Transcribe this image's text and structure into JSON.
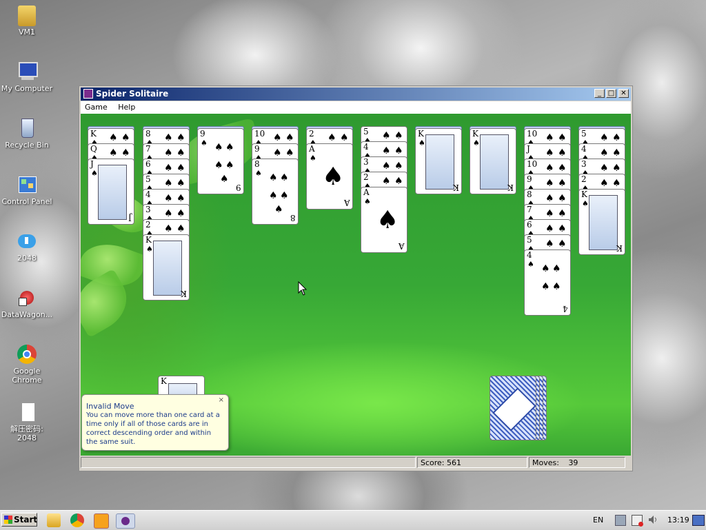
{
  "desktop": {
    "icons": [
      {
        "label": "VM1"
      },
      {
        "label": "My Computer"
      },
      {
        "label": "Recycle Bin"
      },
      {
        "label": "Control Panel"
      },
      {
        "label": "2048"
      },
      {
        "label": "DataWagon..."
      },
      {
        "label": "Google Chrome"
      },
      {
        "label": "解压密码: 2048"
      }
    ]
  },
  "window": {
    "title": "Spider Solitaire",
    "controls": {
      "minimize": "_",
      "maximize": "□",
      "close": "✕"
    },
    "menu": [
      "Game",
      "Help"
    ]
  },
  "tableau": {
    "columns": [
      {
        "cards": [
          "K",
          "Q",
          "J"
        ]
      },
      {
        "cards": [
          "8",
          "7",
          "6",
          "5",
          "4",
          "3",
          "2",
          "K"
        ]
      },
      {
        "cards": [
          "9"
        ]
      },
      {
        "cards": [
          "10",
          "9",
          "8"
        ]
      },
      {
        "cards": [
          "2",
          "A"
        ]
      },
      {
        "cards": [
          "5",
          "4",
          "3",
          "2",
          "A"
        ]
      },
      {
        "cards": [
          "K"
        ]
      },
      {
        "cards": [
          "K"
        ]
      },
      {
        "cards": [
          "10",
          "J",
          "10",
          "9",
          "8",
          "7",
          "6",
          "5",
          "4"
        ]
      },
      {
        "cards": [
          "5",
          "4",
          "3",
          "2",
          "K"
        ]
      }
    ],
    "completed_stack_top": "K",
    "suit": "♠"
  },
  "balloon": {
    "title": "Invalid Move",
    "close": "×",
    "message": "You can move more than one card at a time only if all of those cards are in correct descending order and within the same suit."
  },
  "status": {
    "score_label": "Score:",
    "score": "561",
    "moves_label": "Moves:",
    "moves": "39"
  },
  "taskbar": {
    "start": "Start",
    "language": "EN",
    "clock": "13:19"
  },
  "colors": {
    "felt": "#37a836",
    "title_start": "#0a246a",
    "title_end": "#a6caf0",
    "balloon_bg": "#ffffe1"
  }
}
